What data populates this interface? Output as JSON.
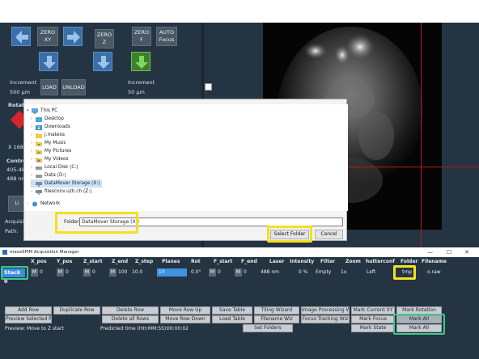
{
  "control_panel": {
    "zero_xy": "ZERO\nXY",
    "zero_z": "ZERO\nZ",
    "zero_f": "ZERO\nF",
    "auto_focus": "AUTO\nFocus",
    "increment_label_left": "Increment",
    "increment_value_left": "500 µm",
    "increment_label_right": "Increment",
    "increment_value_right": "50 µm",
    "load": "LOAD",
    "unload": "UNLOAD",
    "rotation_label": "Rotat",
    "x_readout": "X  168",
    "control_label": "Control",
    "wavelength_1": "405-48",
    "wavelength_2": "488 nm",
    "bottom_btn": "Li",
    "acquisition_label": "Acquisi",
    "path_label": "Path:",
    "accent_blue": "#3a6ea8",
    "go_green": "#4cae38"
  },
  "dialog": {
    "tree": [
      {
        "label": "This PC",
        "icon": "computer-icon",
        "indent": 0,
        "expanded": true
      },
      {
        "label": "Desktop",
        "icon": "folder-icon",
        "indent": 1
      },
      {
        "label": "Downloads",
        "icon": "download-folder-icon",
        "indent": 1
      },
      {
        "label": "j.mateos",
        "icon": "folder-icon",
        "indent": 1
      },
      {
        "label": "My Music",
        "icon": "music-folder-icon",
        "indent": 1
      },
      {
        "label": "My Pictures",
        "icon": "pictures-folder-icon",
        "indent": 1
      },
      {
        "label": "My Videos",
        "icon": "videos-folder-icon",
        "indent": 1
      },
      {
        "label": "Local Disk (C:)",
        "icon": "drive-icon",
        "indent": 1
      },
      {
        "label": "Data (D:)",
        "icon": "drive-icon",
        "indent": 1
      },
      {
        "label": "DataMover Storage (X:)",
        "icon": "network-drive-icon",
        "indent": 1,
        "selected": true
      },
      {
        "label": "filesconv.uzh.ch (Z:)",
        "icon": "network-drive-icon",
        "indent": 1
      },
      {
        "label": "Network",
        "icon": "network-icon",
        "indent": 0
      }
    ],
    "folder_label": "Folder:",
    "folder_value": "DataMover Storage (X:)",
    "select_folder": "Select Folder",
    "cancel": "Cancel",
    "highlight_color": "#f2e11c"
  },
  "acq": {
    "title": "mesoSPIM Acquisition Manager",
    "minimize": "—",
    "maximize": "☐",
    "close": "✕",
    "columns": [
      "X_pos",
      "Y_pos",
      "Z_start",
      "Z_end",
      "Z_step",
      "Planes",
      "Rot",
      "F_start",
      "F_end",
      "Laser",
      "Intensity",
      "Filter",
      "Zoom",
      "hutterconf",
      "Folder",
      "Filename"
    ],
    "row": {
      "stack": "Stack 0",
      "x_m": "M",
      "x": "0",
      "y_m": "M",
      "y": "0",
      "zs_m": "M",
      "zs": "0",
      "ze_m": "M",
      "ze": "100",
      "z_step": "10.0",
      "planes": "10",
      "rot": "0.0°",
      "fs_m": "M",
      "fs": "0",
      "fe_m": "M",
      "fe": "0",
      "laser": "488 nm",
      "intensity": "0 %",
      "filter": "Empty",
      "zoom": "1x",
      "shutter": "Left",
      "folder": "tmp",
      "filename": "o.raw"
    },
    "buttons_row1": [
      "Add Row",
      "Duplicate Row",
      "Delete Row",
      "Move Row Up",
      "Save Table",
      "Tiling Wizard",
      "Image Processing Wiz",
      "Mark Current XY",
      "Mark Rotation"
    ],
    "buttons_row2": [
      "Preview Selected Row",
      "Delete all Rows",
      "Move Row Down",
      "Load Table",
      "Filename Wiz",
      "Focus Tracking Wiz",
      "Mark Focus",
      "Mark All"
    ],
    "buttons_row3": [
      "Set Folders",
      "Mark State",
      "Mark All"
    ],
    "status_text": "Preview: Move to Z start",
    "predicted_label": "Predicted time (HH:MM:SS):",
    "predicted_value": "00:00:02",
    "select_color": "#3b8ee0",
    "highlight_green": "#3ec98b"
  }
}
